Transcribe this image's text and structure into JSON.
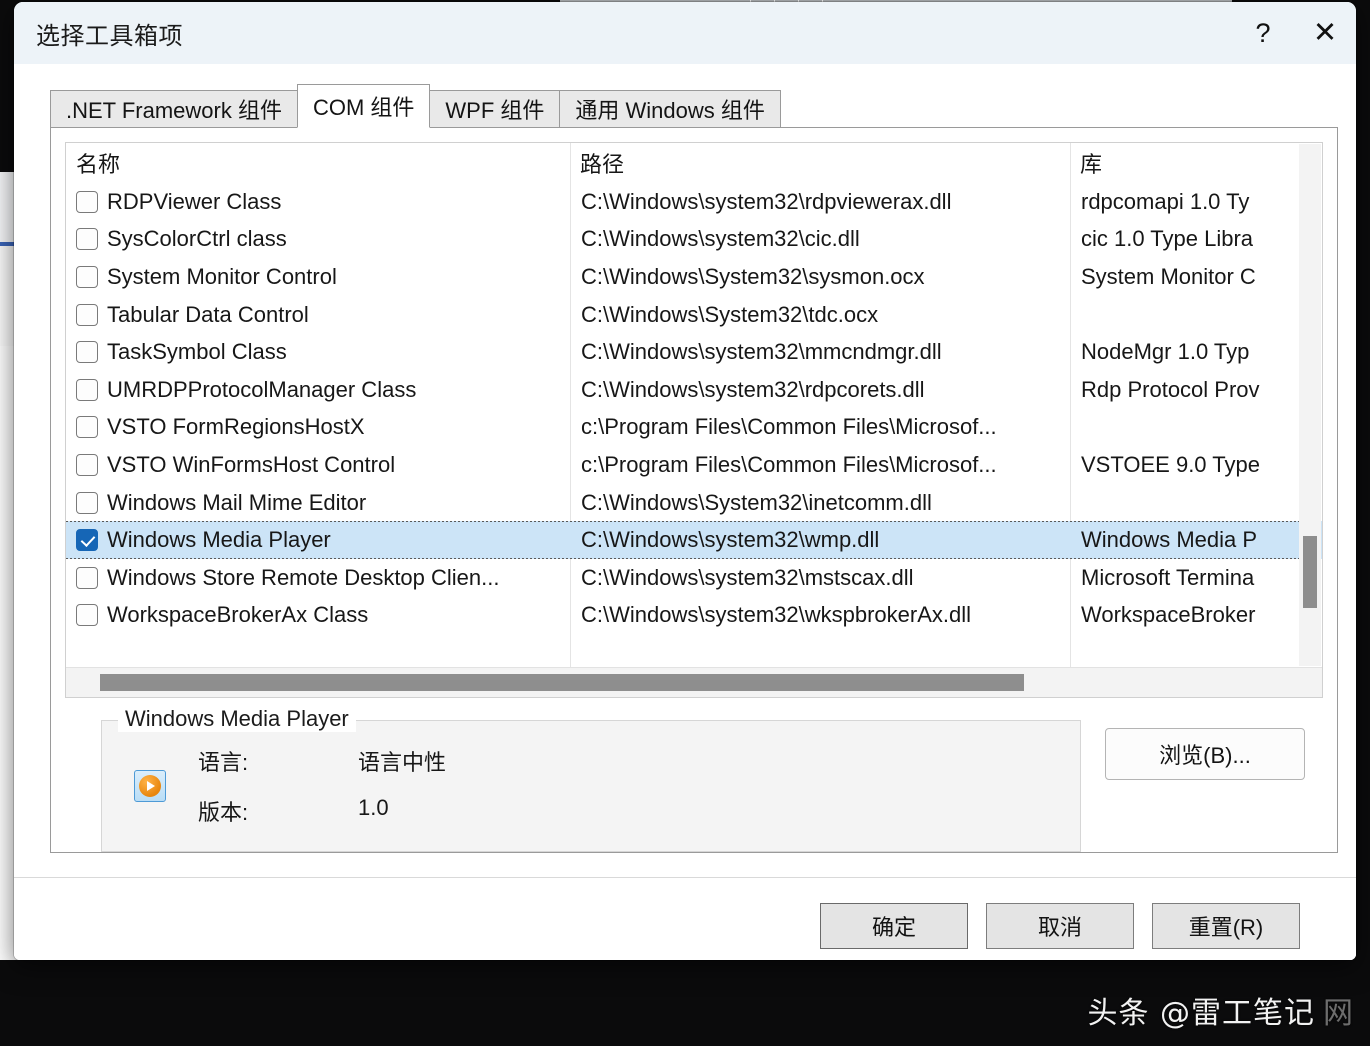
{
  "window": {
    "title": "选择工具箱项",
    "help_label": "?",
    "close_label": "✕"
  },
  "tabs": [
    {
      "label": ".NET Framework 组件",
      "active": false
    },
    {
      "label": "COM 组件",
      "active": true
    },
    {
      "label": "WPF 组件",
      "active": false
    },
    {
      "label": "通用 Windows 组件",
      "active": false
    }
  ],
  "list": {
    "columns": [
      "名称",
      "路径",
      "库"
    ],
    "rows": [
      {
        "checked": false,
        "name": "RDPViewer Class",
        "path": "C:\\Windows\\system32\\rdpviewerax.dll",
        "lib": "rdpcomapi 1.0 Ty",
        "selected": false
      },
      {
        "checked": false,
        "name": "SysColorCtrl class",
        "path": "C:\\Windows\\system32\\cic.dll",
        "lib": "cic 1.0 Type Libra",
        "selected": false
      },
      {
        "checked": false,
        "name": "System Monitor Control",
        "path": "C:\\Windows\\System32\\sysmon.ocx",
        "lib": "System Monitor C",
        "selected": false
      },
      {
        "checked": false,
        "name": "Tabular Data Control",
        "path": "C:\\Windows\\System32\\tdc.ocx",
        "lib": "",
        "selected": false
      },
      {
        "checked": false,
        "name": "TaskSymbol Class",
        "path": "C:\\Windows\\system32\\mmcndmgr.dll",
        "lib": "NodeMgr 1.0 Typ",
        "selected": false
      },
      {
        "checked": false,
        "name": "UMRDPProtocolManager  Class",
        "path": "C:\\Windows\\system32\\rdpcorets.dll",
        "lib": "Rdp Protocol Prov",
        "selected": false
      },
      {
        "checked": false,
        "name": "VSTO FormRegionsHostX",
        "path": "c:\\Program Files\\Common Files\\Microsof...",
        "lib": "",
        "selected": false
      },
      {
        "checked": false,
        "name": "VSTO WinFormsHost Control",
        "path": "c:\\Program Files\\Common Files\\Microsof...",
        "lib": "VSTOEE 9.0 Type",
        "selected": false
      },
      {
        "checked": false,
        "name": "Windows Mail Mime Editor",
        "path": "C:\\Windows\\System32\\inetcomm.dll",
        "lib": "",
        "selected": false
      },
      {
        "checked": true,
        "name": "Windows Media Player",
        "path": "C:\\Windows\\system32\\wmp.dll",
        "lib": "Windows Media P",
        "selected": true
      },
      {
        "checked": false,
        "name": "Windows Store Remote Desktop Clien...",
        "path": "C:\\Windows\\system32\\mstscax.dll",
        "lib": "Microsoft Termina",
        "selected": false
      },
      {
        "checked": false,
        "name": "WorkspaceBrokerAx Class",
        "path": "C:\\Windows\\system32\\wkspbrokerAx.dll",
        "lib": "WorkspaceBroker",
        "selected": false
      }
    ]
  },
  "details": {
    "legend": "Windows Media Player",
    "icon_name": "windows-media-player-icon",
    "fields": [
      {
        "key": "语言:",
        "value": "语言中性"
      },
      {
        "key": "版本:",
        "value": "1.0"
      }
    ]
  },
  "browse_button": {
    "label": "浏览(B)..."
  },
  "footer_buttons": [
    {
      "label": "确定",
      "name": "ok-button"
    },
    {
      "label": "取消",
      "name": "cancel-button"
    },
    {
      "label": "重置(R)",
      "name": "reset-button"
    }
  ],
  "watermark": {
    "text": "头条 @雷工笔记",
    "ghost": "网"
  },
  "colors": {
    "selection": "#cce4f7",
    "checkbox_checked": "#1666b6",
    "titlebar": "#edf3f8",
    "scrollbar_thumb": "#8e8e8e"
  }
}
